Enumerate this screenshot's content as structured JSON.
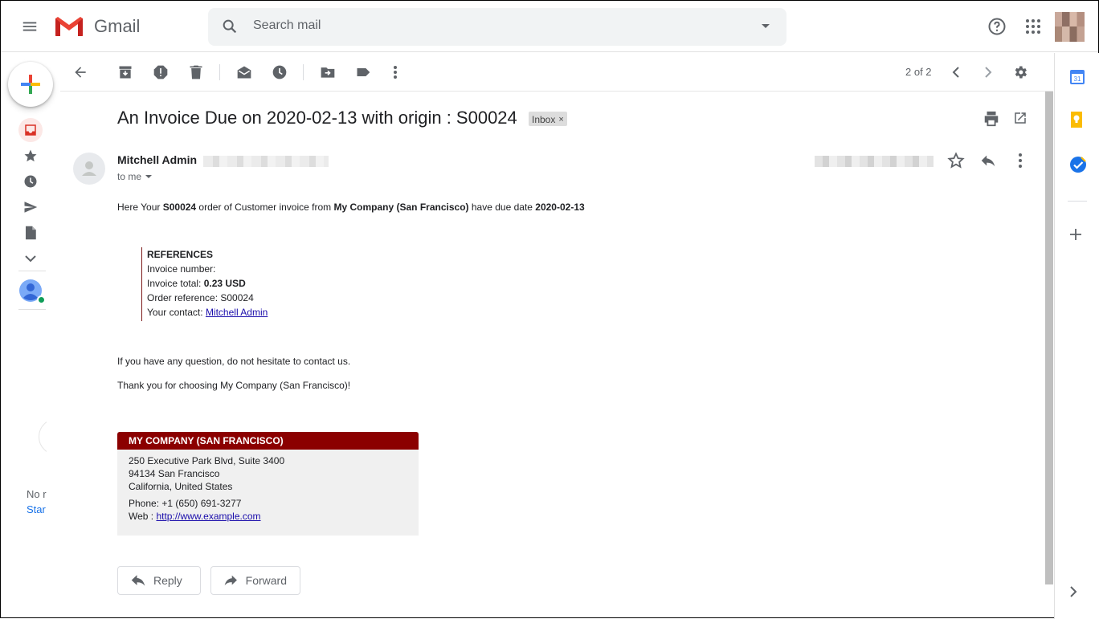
{
  "app": {
    "name": "Gmail"
  },
  "search": {
    "placeholder": "Search mail"
  },
  "toolbar": {
    "pagination": "2 of 2"
  },
  "message": {
    "subject": "An Invoice Due on 2020-02-13 with origin : S00024",
    "label": "Inbox",
    "label_close": "×",
    "sender": "Mitchell Admin",
    "recipient": "to me",
    "intro_prefix": "Here Your ",
    "intro_order": "S00024",
    "intro_mid": " order of Customer invoice from ",
    "intro_company": "My Company (San Francisco)",
    "intro_suffix": " have due date ",
    "intro_date": "2020-02-13",
    "references": {
      "title": "REFERENCES",
      "invoice_number_label": "Invoice number:",
      "invoice_total_label": "Invoice total: ",
      "invoice_total_value": "0.23 USD",
      "order_reference": "Order reference: S00024",
      "contact_label": "Your contact: ",
      "contact_name": "Mitchell Admin"
    },
    "question_line": "If you have any question, do not hesitate to contact us.",
    "thanks_line": "Thank you for choosing My Company (San Francisco)!",
    "company_card": {
      "name": "MY COMPANY (SAN FRANCISCO)",
      "address1": "250 Executive Park Blvd, Suite 3400",
      "address2": "94134 San Francisco",
      "address3": "California, United States",
      "phone": "Phone:  +1 (650) 691-3277",
      "web_label": "Web : ",
      "web_url": "http://www.example.com"
    }
  },
  "actions": {
    "reply": "Reply",
    "forward": "Forward"
  },
  "sidebar_left": {
    "partial_text_1": "No r",
    "partial_text_2": "Star"
  },
  "colors": {
    "card_header": "#8b0000",
    "link": "#1a0dab",
    "gmail_red": "#ea4335",
    "reference_border": "#7c1b1b"
  },
  "icons": {
    "menu": "menu-icon",
    "search": "search-icon",
    "help": "help-icon",
    "apps": "apps-grid-icon",
    "back": "arrow-back-icon",
    "archive": "archive-icon",
    "spam": "report-spam-icon",
    "delete": "trash-icon",
    "mark_unread": "mark-unread-icon",
    "snooze": "snooze-clock-icon",
    "move": "move-to-icon",
    "label": "label-icon",
    "more": "more-vert-icon",
    "prev": "chevron-left-icon",
    "next": "chevron-right-icon",
    "settings": "gear-icon",
    "print": "print-icon",
    "popout": "open-in-new-window-icon",
    "star": "star-outline-icon",
    "reply": "reply-icon"
  }
}
